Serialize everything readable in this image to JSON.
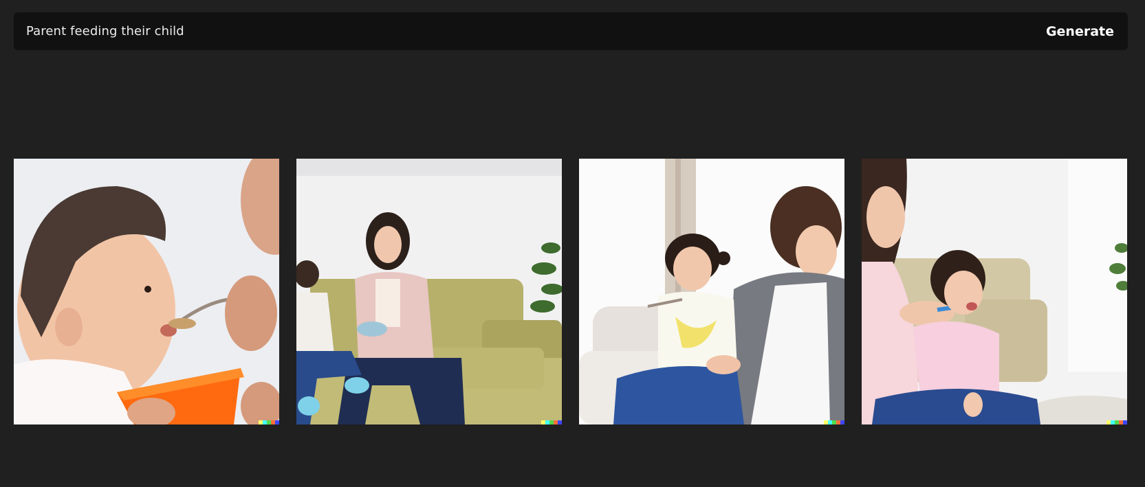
{
  "prompt": {
    "text": "Parent feeding their child",
    "generate_label": "Generate"
  },
  "images": [
    {
      "id": "image-1",
      "icon": "generated-image"
    },
    {
      "id": "image-2",
      "icon": "generated-image"
    },
    {
      "id": "image-3",
      "icon": "generated-image"
    },
    {
      "id": "image-4",
      "icon": "generated-image"
    }
  ],
  "watermark_colors": [
    "#ffff66",
    "#42ffff",
    "#51da4c",
    "#ff6e3c",
    "#3c46ff"
  ]
}
